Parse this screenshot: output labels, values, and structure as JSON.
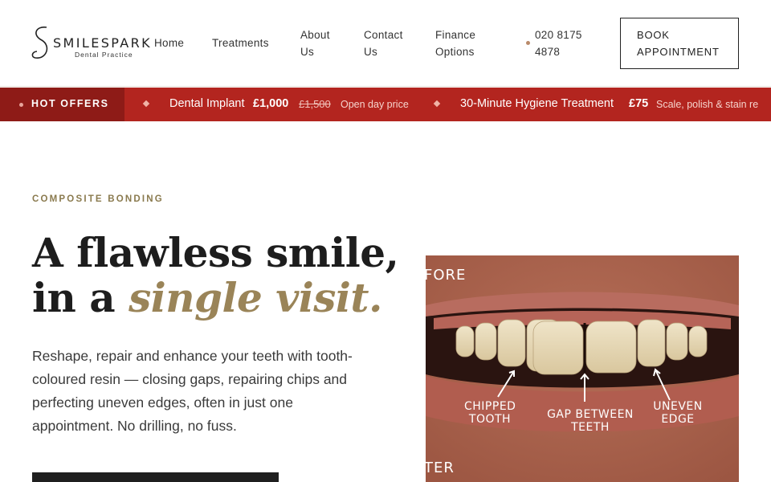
{
  "brand": {
    "name": "SMILESPARK",
    "tagline": "Dental Practice"
  },
  "nav": {
    "items": [
      {
        "label": "Home"
      },
      {
        "label": "Treatments"
      },
      {
        "label": "About Us"
      },
      {
        "label": "Contact Us"
      },
      {
        "label": "Finance Options"
      }
    ],
    "phone": "020 8175 4878",
    "book_label": "BOOK APPOINTMENT"
  },
  "offers": {
    "label": "HOT OFFERS",
    "items": [
      {
        "name": "Dental Implant",
        "price": "£1,000",
        "old_price": "£1,500",
        "note": "Open day price"
      },
      {
        "name": "30-Minute Hygiene Treatment",
        "price": "£75",
        "note": "Scale, polish & stain re"
      }
    ]
  },
  "hero": {
    "eyebrow": "COMPOSITE BONDING",
    "headline_line1": "A flawless smile,",
    "headline_line2_plain": "in a ",
    "headline_line2_accent": "single visit.",
    "body": "Reshape, repair and enhance your teeth with tooth-coloured resin — closing gaps, repairing chips and perfecting uneven edges, often in just one appointment. No drilling, no fuss."
  },
  "photo": {
    "corner_top": "FORE",
    "corner_bottom": "TER",
    "labels": [
      {
        "line1": "CHIPPED",
        "line2": "TOOTH"
      },
      {
        "line1": "GAP BETWEEN",
        "line2": "TEETH"
      },
      {
        "line1": "UNEVEN",
        "line2": "EDGE"
      }
    ]
  },
  "colors": {
    "accent_gold": "#9a8458",
    "offers_red": "#b3251f",
    "offers_dark": "#8e1b17"
  }
}
